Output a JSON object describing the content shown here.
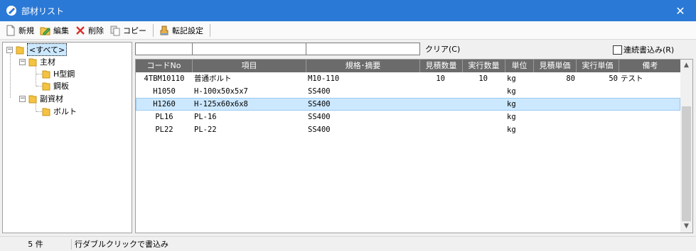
{
  "window": {
    "title": "部材リスト",
    "close_glyph": "✕"
  },
  "toolbar": {
    "new_label": "新規",
    "edit_label": "編集",
    "delete_label": "削除",
    "copy_label": "コピー",
    "transfer_label": "転記設定"
  },
  "tree": {
    "root": "<すべて>",
    "main": "主材",
    "main_children": [
      "H型鋼",
      "鋼板"
    ],
    "sub": "副資材",
    "sub_children": [
      "ボルト"
    ]
  },
  "filter": {
    "clear_label": "クリア(C)",
    "continuous_label": "連続書込み(R)",
    "continuous_checked": false
  },
  "grid": {
    "headers": [
      "コードNo",
      "項目",
      "規格･摘要",
      "見積数量",
      "実行数量",
      "単位",
      "見積単価",
      "実行単価",
      "備考"
    ],
    "rows": [
      [
        "4TBM10110",
        "普通ボルト",
        "M10-110",
        "10",
        "10",
        "kg",
        "80",
        "50",
        "テスト"
      ],
      [
        "H1050",
        "H-100x50x5x7",
        "SS400",
        "",
        "",
        "kg",
        "",
        "",
        ""
      ],
      [
        "H1260",
        "H-125x60x6x8",
        "SS400",
        "",
        "",
        "kg",
        "",
        "",
        ""
      ],
      [
        "PL16",
        "PL-16",
        "SS400",
        "",
        "",
        "kg",
        "",
        "",
        ""
      ],
      [
        "PL22",
        "PL-22",
        "SS400",
        "",
        "",
        "kg",
        "",
        "",
        ""
      ]
    ],
    "selected_row": 2
  },
  "status": {
    "count": "5 件",
    "hint": "行ダブルクリックで書込み"
  },
  "colors": {
    "titlebar": "#2b79d7",
    "header": "#6b6b6b",
    "selection": "#cce8ff"
  }
}
